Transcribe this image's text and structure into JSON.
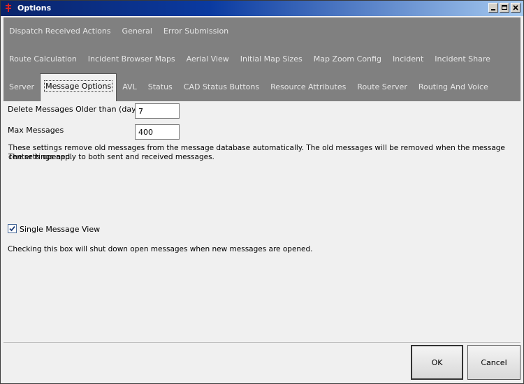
{
  "window": {
    "title": "Options"
  },
  "tabs": {
    "row1": [
      "Dispatch Received Actions",
      "General",
      "Error Submission"
    ],
    "row2": [
      "Route Calculation",
      "Incident Browser Maps",
      "Aerial View",
      "Initial Map Sizes",
      "Map Zoom Config",
      "Incident",
      "Incident Share"
    ],
    "row3": [
      "Server",
      "Message Options",
      "AVL",
      "Status",
      "CAD Status Buttons",
      "Resource Attributes",
      "Route Server",
      "Routing And Voice"
    ],
    "active": "Message Options"
  },
  "message_options": {
    "delete_label": "Delete Messages Older than (days)",
    "delete_value": "7",
    "max_label": "Max Messages",
    "max_value": "400",
    "note_line1": "These settings remove old messages from the message database automatically.  The old messages will be removed when the message center is opened.",
    "note_line2": "The settings apply to both sent and received messages.",
    "single_view_label": "Single Message View",
    "single_view_checked": true,
    "single_view_note": "Checking this box will shut down open messages when new messages are opened."
  },
  "buttons": {
    "ok": "OK",
    "cancel": "Cancel"
  }
}
